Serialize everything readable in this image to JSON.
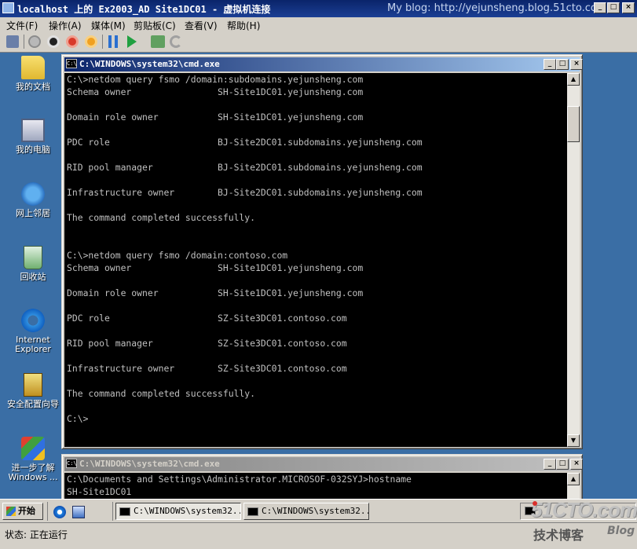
{
  "host": {
    "title": "localhost 上的 Ex2003_AD Site1DC01 - 虚拟机连接",
    "watermark": "My blog: http://yejunsheng.blog.51cto.com",
    "controls": {
      "minimize": "_",
      "maximize": "□",
      "close": "×"
    }
  },
  "menu": {
    "items": [
      "文件(F)",
      "操作(A)",
      "媒体(M)",
      "剪贴板(C)",
      "查看(V)",
      "帮助(H)"
    ]
  },
  "toolbar": {
    "tools": [
      "ctrl-alt-del-icon",
      "start-icon",
      "turn-off-icon",
      "shutdown-icon",
      "reset-icon",
      "pause-icon",
      "resume-icon",
      "snapshot-icon",
      "revert-icon"
    ]
  },
  "desktop": {
    "icons": [
      {
        "label": "我的文档"
      },
      {
        "label": "我的电脑"
      },
      {
        "label": "网上邻居"
      },
      {
        "label": "回收站"
      },
      {
        "label_line1": "Internet",
        "label_line2": "Explorer"
      },
      {
        "label": "安全配置向导"
      },
      {
        "label_line1": "进一步了解",
        "label_line2": "Windows ..."
      }
    ]
  },
  "cmd1": {
    "title": "C:\\WINDOWS\\system32\\cmd.exe",
    "lines": [
      "C:\\>netdom query fsmo /domain:subdomains.yejunsheng.com",
      "Schema owner                SH-Site1DC01.yejunsheng.com",
      "",
      "Domain role owner           SH-Site1DC01.yejunsheng.com",
      "",
      "PDC role                    BJ-Site2DC01.subdomains.yejunsheng.com",
      "",
      "RID pool manager            BJ-Site2DC01.subdomains.yejunsheng.com",
      "",
      "Infrastructure owner        BJ-Site2DC01.subdomains.yejunsheng.com",
      "",
      "The command completed successfully.",
      "",
      "",
      "C:\\>netdom query fsmo /domain:contoso.com",
      "Schema owner                SH-Site1DC01.yejunsheng.com",
      "",
      "Domain role owner           SH-Site1DC01.yejunsheng.com",
      "",
      "PDC role                    SZ-Site3DC01.contoso.com",
      "",
      "RID pool manager            SZ-Site3DC01.contoso.com",
      "",
      "Infrastructure owner        SZ-Site3DC01.contoso.com",
      "",
      "The command completed successfully.",
      "",
      "C:\\>"
    ]
  },
  "cmd2": {
    "title": "C:\\WINDOWS\\system32\\cmd.exe",
    "lines": [
      "C:\\Documents and Settings\\Administrator.MICROSOF-032SYJ>hostname",
      "SH-Site1DC01"
    ]
  },
  "taskbar": {
    "start": "开始",
    "tasks": [
      "C:\\WINDOWS\\system32...",
      "C:\\WINDOWS\\system32..."
    ]
  },
  "statusbar": {
    "status": "状态: 正在运行"
  },
  "branding": {
    "site": "51CTO.com",
    "tagline": "技术博客",
    "blog": "Blog"
  },
  "colors": {
    "titlebar": "#0a246a",
    "desktop": "#3a6ea5",
    "console_bg": "#000000",
    "console_fg": "#c0c0c0",
    "logo_red": "#d9302c"
  }
}
